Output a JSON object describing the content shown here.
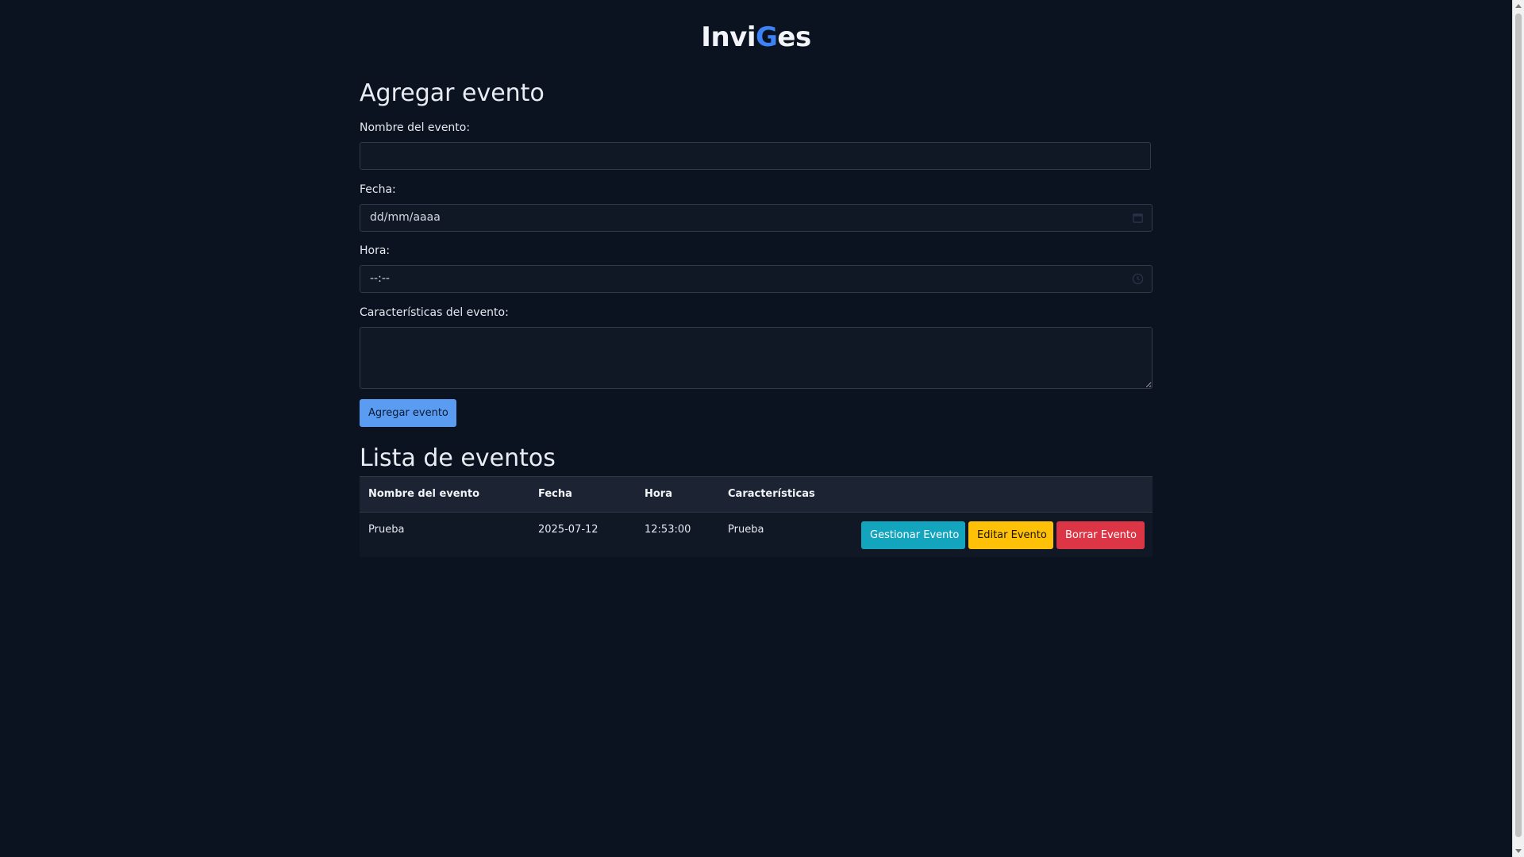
{
  "brand": {
    "prefix": "Invi",
    "accent": "G",
    "suffix": "es"
  },
  "form": {
    "title": "Agregar evento",
    "name_label": "Nombre del evento:",
    "name_value": "",
    "date_label": "Fecha:",
    "date_value": "dd/mm/aaaa",
    "time_label": "Hora:",
    "time_value": "--:--",
    "features_label": "Características del evento:",
    "features_value": "",
    "submit_label": "Agregar evento"
  },
  "list": {
    "title": "Lista de eventos",
    "headers": [
      "Nombre del evento",
      "Fecha",
      "Hora",
      "Características"
    ],
    "rows": [
      {
        "name": "Prueba",
        "date": "2025-07-12",
        "time": "12:53:00",
        "features": "Prueba",
        "manage_label": "Gestionar Evento",
        "edit_label": "Editar Evento",
        "delete_label": "Borrar Evento"
      }
    ]
  },
  "colors": {
    "background": "#0b1220",
    "accent": "#3b82f6",
    "primary_button": "#5b9cf3",
    "info_button": "#13a5bd",
    "warning_button": "#ffc107",
    "danger_button": "#dc3545"
  },
  "icons": {
    "date_field": "calendar-icon",
    "time_field": "clock-icon"
  }
}
